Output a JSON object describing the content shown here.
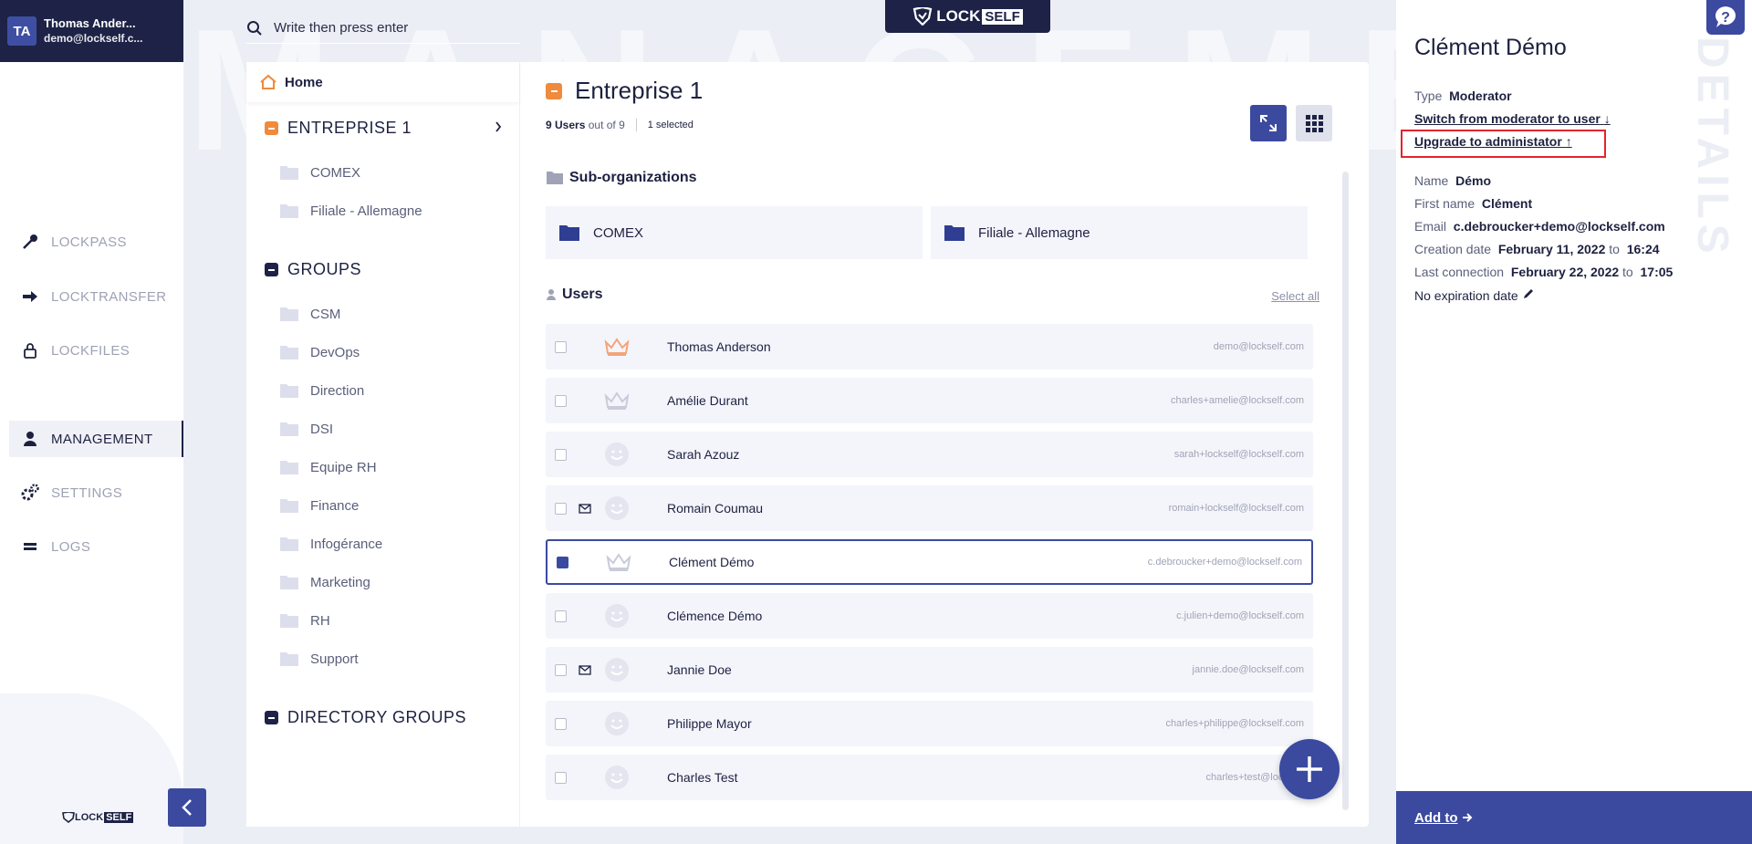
{
  "user": {
    "initials": "TA",
    "name": "Thomas Ander...",
    "email": "demo@lockself.c..."
  },
  "nav": [
    {
      "label": "LOCKPASS",
      "icon": "lockpass-icon"
    },
    {
      "label": "LOCKTRANSFER",
      "icon": "arrow-right-icon"
    },
    {
      "label": "LOCKFILES",
      "icon": "lock-icon"
    },
    {
      "label": "MANAGEMENT",
      "icon": "person-icon",
      "active": true
    },
    {
      "label": "SETTINGS",
      "icon": "gears-icon"
    },
    {
      "label": "LOGS",
      "icon": "logs-icon"
    }
  ],
  "brand": {
    "lock": "LOCK",
    "self": "SELF"
  },
  "background_word": "MANAGEMENT",
  "search": {
    "placeholder": "Write then press enter"
  },
  "tree": {
    "home": "Home",
    "entreprise": "ENTREPRISE 1",
    "entreprise_children": [
      "COMEX",
      "Filiale - Allemagne"
    ],
    "groups_title": "GROUPS",
    "groups": [
      "CSM",
      "DevOps",
      "Direction",
      "DSI",
      "Equipe RH",
      "Finance",
      "Infogérance",
      "Marketing",
      "RH",
      "Support"
    ],
    "directory_groups": "DIRECTORY GROUPS"
  },
  "content": {
    "title": "Entreprise 1",
    "users_count": "9 Users",
    "out_of": "out of 9",
    "selected": "1 selected",
    "suborg_title": "Sub-organizations",
    "suborgs": [
      "COMEX",
      "Filiale - Allemagne"
    ],
    "users_title": "Users",
    "select_all": "Select all",
    "users": [
      {
        "name": "Thomas Anderson",
        "email": "demo@lockself.com",
        "role": "admin",
        "mail": false,
        "checked": false
      },
      {
        "name": "Amélie Durant",
        "email": "charles+amelie@lockself.com",
        "role": "moderator",
        "mail": false,
        "checked": false
      },
      {
        "name": "Sarah Azouz",
        "email": "sarah+lockself@lockself.com",
        "role": "user",
        "mail": false,
        "checked": false
      },
      {
        "name": "Romain Coumau",
        "email": "romain+lockself@lockself.com",
        "role": "user",
        "mail": true,
        "checked": false
      },
      {
        "name": "Clément Démo",
        "email": "c.debroucker+demo@lockself.com",
        "role": "moderator",
        "mail": false,
        "checked": true
      },
      {
        "name": "Clémence Démo",
        "email": "c.julien+demo@lockself.com",
        "role": "user",
        "mail": false,
        "checked": false
      },
      {
        "name": "Jannie Doe",
        "email": "jannie.doe@lockself.com",
        "role": "user",
        "mail": true,
        "checked": false
      },
      {
        "name": "Philippe Mayor",
        "email": "charles+philippe@lockself.com",
        "role": "user",
        "mail": false,
        "checked": false
      },
      {
        "name": "Charles Test",
        "email": "charles+test@lockself",
        "role": "user",
        "mail": false,
        "checked": false
      }
    ]
  },
  "details": {
    "watermark": "DETAILS",
    "title": "Clément Démo",
    "type_label": "Type",
    "type_value": "Moderator",
    "switch_link": "Switch from moderator to user",
    "upgrade_link": "Upgrade to administator",
    "name_label": "Name",
    "name_value": "Démo",
    "first_name_label": "First name",
    "first_name_value": "Clément",
    "email_label": "Email",
    "email_value": "c.debroucker+demo@lockself.com",
    "creation_label": "Creation date",
    "creation_date": "February 11, 2022",
    "creation_to": "to",
    "creation_time": "16:24",
    "last_label": "Last connection",
    "last_date": "February 22, 2022",
    "last_to": "to",
    "last_time": "17:05",
    "expiration": "No expiration date",
    "add_to": "Add to"
  },
  "colors": {
    "navy": "#1d2246",
    "accent": "#3b4a9f",
    "orange": "#f08a3c",
    "highlight": "#e3242b"
  }
}
